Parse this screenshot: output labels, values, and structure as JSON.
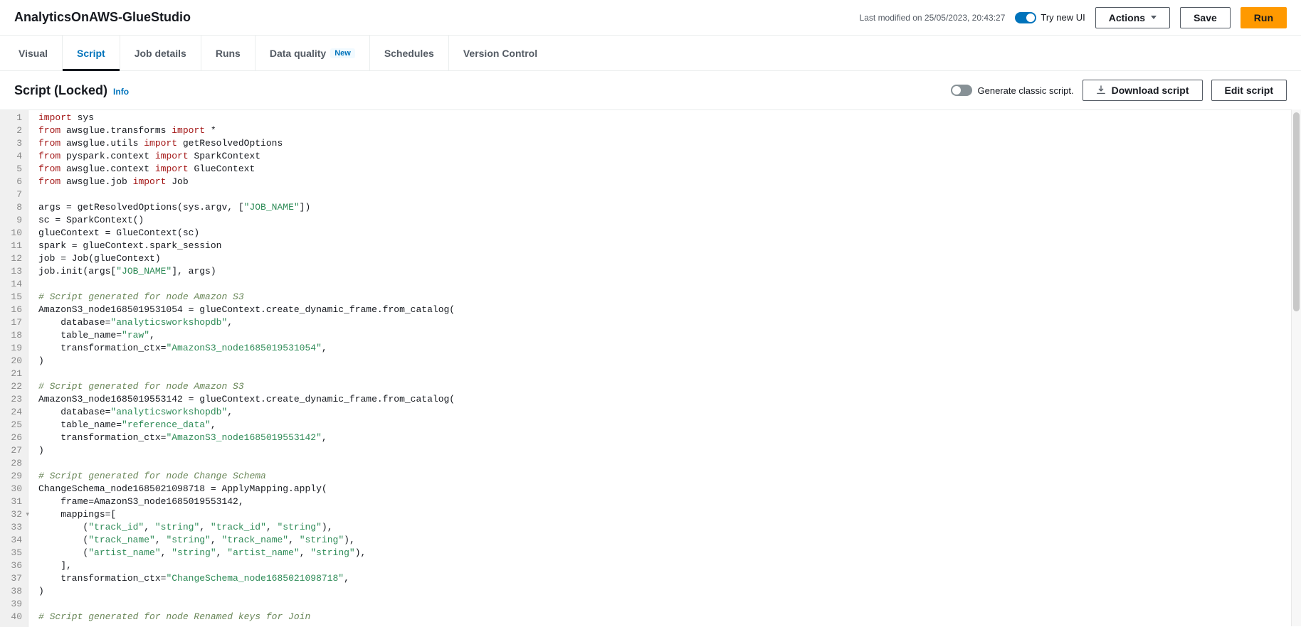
{
  "header": {
    "title": "AnalyticsOnAWS-GlueStudio",
    "last_modified": "Last modified on 25/05/2023, 20:43:27",
    "try_new_ui": "Try new UI",
    "actions": "Actions",
    "save": "Save",
    "run": "Run"
  },
  "tabs": {
    "items": [
      {
        "label": "Visual"
      },
      {
        "label": "Script"
      },
      {
        "label": "Job details"
      },
      {
        "label": "Runs"
      },
      {
        "label": "Data quality",
        "badge": "New"
      },
      {
        "label": "Schedules"
      },
      {
        "label": "Version Control"
      }
    ]
  },
  "subheader": {
    "title": "Script (Locked)",
    "info": "Info",
    "generate_classic": "Generate classic script.",
    "download": "Download script",
    "edit": "Edit script"
  },
  "code": {
    "lines": [
      {
        "n": 1,
        "t": "kw",
        "seg": [
          [
            "kw",
            "import "
          ],
          [
            "id",
            "sys"
          ]
        ]
      },
      {
        "n": 2,
        "seg": [
          [
            "kw",
            "from "
          ],
          [
            "id",
            "awsglue.transforms "
          ],
          [
            "kw",
            "import "
          ],
          [
            "id",
            "*"
          ]
        ]
      },
      {
        "n": 3,
        "seg": [
          [
            "kw",
            "from "
          ],
          [
            "id",
            "awsglue.utils "
          ],
          [
            "kw",
            "import "
          ],
          [
            "id",
            "getResolvedOptions"
          ]
        ]
      },
      {
        "n": 4,
        "seg": [
          [
            "kw",
            "from "
          ],
          [
            "id",
            "pyspark.context "
          ],
          [
            "kw",
            "import "
          ],
          [
            "id",
            "SparkContext"
          ]
        ]
      },
      {
        "n": 5,
        "seg": [
          [
            "kw",
            "from "
          ],
          [
            "id",
            "awsglue.context "
          ],
          [
            "kw",
            "import "
          ],
          [
            "id",
            "GlueContext"
          ]
        ]
      },
      {
        "n": 6,
        "seg": [
          [
            "kw",
            "from "
          ],
          [
            "id",
            "awsglue.job "
          ],
          [
            "kw",
            "import "
          ],
          [
            "id",
            "Job"
          ]
        ]
      },
      {
        "n": 7,
        "seg": [
          [
            "id",
            ""
          ]
        ]
      },
      {
        "n": 8,
        "seg": [
          [
            "id",
            "args = getResolvedOptions(sys.argv, ["
          ],
          [
            "str",
            "\"JOB_NAME\""
          ],
          [
            "id",
            "])"
          ]
        ]
      },
      {
        "n": 9,
        "seg": [
          [
            "id",
            "sc = SparkContext()"
          ]
        ]
      },
      {
        "n": 10,
        "seg": [
          [
            "id",
            "glueContext = GlueContext(sc)"
          ]
        ]
      },
      {
        "n": 11,
        "seg": [
          [
            "id",
            "spark = glueContext.spark_session"
          ]
        ]
      },
      {
        "n": 12,
        "seg": [
          [
            "id",
            "job = Job(glueContext)"
          ]
        ]
      },
      {
        "n": 13,
        "seg": [
          [
            "id",
            "job.init(args["
          ],
          [
            "str",
            "\"JOB_NAME\""
          ],
          [
            "id",
            "], args)"
          ]
        ]
      },
      {
        "n": 14,
        "seg": [
          [
            "id",
            ""
          ]
        ]
      },
      {
        "n": 15,
        "seg": [
          [
            "cm",
            "# Script generated for node Amazon S3"
          ]
        ]
      },
      {
        "n": 16,
        "seg": [
          [
            "id",
            "AmazonS3_node1685019531054 = glueContext.create_dynamic_frame.from_catalog("
          ]
        ]
      },
      {
        "n": 17,
        "seg": [
          [
            "id",
            "    database="
          ],
          [
            "str",
            "\"analyticsworkshopdb\""
          ],
          [
            "id",
            ","
          ]
        ]
      },
      {
        "n": 18,
        "seg": [
          [
            "id",
            "    table_name="
          ],
          [
            "str",
            "\"raw\""
          ],
          [
            "id",
            ","
          ]
        ]
      },
      {
        "n": 19,
        "seg": [
          [
            "id",
            "    transformation_ctx="
          ],
          [
            "str",
            "\"AmazonS3_node1685019531054\""
          ],
          [
            "id",
            ","
          ]
        ]
      },
      {
        "n": 20,
        "seg": [
          [
            "id",
            ")"
          ]
        ]
      },
      {
        "n": 21,
        "seg": [
          [
            "id",
            ""
          ]
        ]
      },
      {
        "n": 22,
        "seg": [
          [
            "cm",
            "# Script generated for node Amazon S3"
          ]
        ]
      },
      {
        "n": 23,
        "seg": [
          [
            "id",
            "AmazonS3_node1685019553142 = glueContext.create_dynamic_frame.from_catalog("
          ]
        ]
      },
      {
        "n": 24,
        "seg": [
          [
            "id",
            "    database="
          ],
          [
            "str",
            "\"analyticsworkshopdb\""
          ],
          [
            "id",
            ","
          ]
        ]
      },
      {
        "n": 25,
        "seg": [
          [
            "id",
            "    table_name="
          ],
          [
            "str",
            "\"reference_data\""
          ],
          [
            "id",
            ","
          ]
        ]
      },
      {
        "n": 26,
        "seg": [
          [
            "id",
            "    transformation_ctx="
          ],
          [
            "str",
            "\"AmazonS3_node1685019553142\""
          ],
          [
            "id",
            ","
          ]
        ]
      },
      {
        "n": 27,
        "seg": [
          [
            "id",
            ")"
          ]
        ]
      },
      {
        "n": 28,
        "seg": [
          [
            "id",
            ""
          ]
        ]
      },
      {
        "n": 29,
        "seg": [
          [
            "cm",
            "# Script generated for node Change Schema"
          ]
        ]
      },
      {
        "n": 30,
        "seg": [
          [
            "id",
            "ChangeSchema_node1685021098718 = ApplyMapping.apply("
          ]
        ]
      },
      {
        "n": 31,
        "seg": [
          [
            "id",
            "    frame=AmazonS3_node1685019553142,"
          ]
        ]
      },
      {
        "n": 32,
        "fold": true,
        "seg": [
          [
            "id",
            "    mappings=["
          ]
        ]
      },
      {
        "n": 33,
        "seg": [
          [
            "id",
            "        ("
          ],
          [
            "str",
            "\"track_id\""
          ],
          [
            "id",
            ", "
          ],
          [
            "str",
            "\"string\""
          ],
          [
            "id",
            ", "
          ],
          [
            "str",
            "\"track_id\""
          ],
          [
            "id",
            ", "
          ],
          [
            "str",
            "\"string\""
          ],
          [
            "id",
            "),"
          ]
        ]
      },
      {
        "n": 34,
        "seg": [
          [
            "id",
            "        ("
          ],
          [
            "str",
            "\"track_name\""
          ],
          [
            "id",
            ", "
          ],
          [
            "str",
            "\"string\""
          ],
          [
            "id",
            ", "
          ],
          [
            "str",
            "\"track_name\""
          ],
          [
            "id",
            ", "
          ],
          [
            "str",
            "\"string\""
          ],
          [
            "id",
            "),"
          ]
        ]
      },
      {
        "n": 35,
        "seg": [
          [
            "id",
            "        ("
          ],
          [
            "str",
            "\"artist_name\""
          ],
          [
            "id",
            ", "
          ],
          [
            "str",
            "\"string\""
          ],
          [
            "id",
            ", "
          ],
          [
            "str",
            "\"artist_name\""
          ],
          [
            "id",
            ", "
          ],
          [
            "str",
            "\"string\""
          ],
          [
            "id",
            "),"
          ]
        ]
      },
      {
        "n": 36,
        "seg": [
          [
            "id",
            "    ],"
          ]
        ]
      },
      {
        "n": 37,
        "seg": [
          [
            "id",
            "    transformation_ctx="
          ],
          [
            "str",
            "\"ChangeSchema_node1685021098718\""
          ],
          [
            "id",
            ","
          ]
        ]
      },
      {
        "n": 38,
        "seg": [
          [
            "id",
            ")"
          ]
        ]
      },
      {
        "n": 39,
        "seg": [
          [
            "id",
            ""
          ]
        ]
      },
      {
        "n": 40,
        "seg": [
          [
            "cm",
            "# Script generated for node Renamed keys for Join"
          ]
        ]
      }
    ]
  }
}
